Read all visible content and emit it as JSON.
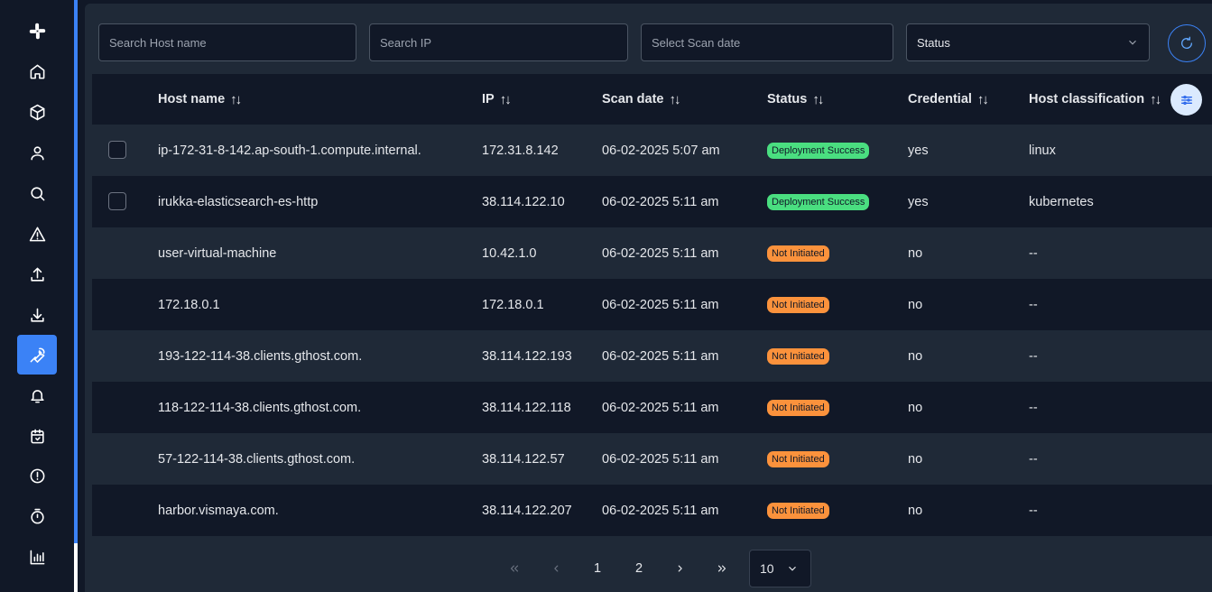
{
  "sidebar": {
    "items": [
      {
        "icon": "slack-icon"
      },
      {
        "icon": "home-icon"
      },
      {
        "icon": "cube-icon"
      },
      {
        "icon": "user-icon"
      },
      {
        "icon": "search-icon"
      },
      {
        "icon": "warning-icon"
      },
      {
        "icon": "upload-icon"
      },
      {
        "icon": "download-icon"
      },
      {
        "icon": "wrench-icon",
        "active": true
      },
      {
        "icon": "bell-icon"
      },
      {
        "icon": "calendar-icon"
      },
      {
        "icon": "alert-circle-icon"
      },
      {
        "icon": "timer-icon"
      },
      {
        "icon": "bar-chart-icon"
      }
    ]
  },
  "filters": {
    "host_placeholder": "Search Host name",
    "ip_placeholder": "Search IP",
    "date_placeholder": "Select Scan date",
    "status_label": "Status"
  },
  "table": {
    "headers": {
      "host": "Host name",
      "ip": "IP",
      "scan_date": "Scan date",
      "status": "Status",
      "credential": "Credential",
      "classification": "Host classification"
    },
    "sort_glyph": "↑↓",
    "rows": [
      {
        "host": "ip-172-31-8-142.ap-south-1.compute.internal.",
        "ip": "172.31.8.142",
        "date": "06-02-2025 5:07 am",
        "status": "Deployment Success",
        "credential": "yes",
        "classification": "linux"
      },
      {
        "host": "irukka-elasticsearch-es-http",
        "ip": "38.114.122.10",
        "date": "06-02-2025 5:11 am",
        "status": "Deployment Success",
        "credential": "yes",
        "classification": "kubernetes"
      },
      {
        "host": "user-virtual-machine",
        "ip": "10.42.1.0",
        "date": "06-02-2025 5:11 am",
        "status": "Not Initiated",
        "credential": "no",
        "classification": "--"
      },
      {
        "host": "172.18.0.1",
        "ip": "172.18.0.1",
        "date": "06-02-2025 5:11 am",
        "status": "Not Initiated",
        "credential": "no",
        "classification": "--"
      },
      {
        "host": "193-122-114-38.clients.gthost.com.",
        "ip": "38.114.122.193",
        "date": "06-02-2025 5:11 am",
        "status": "Not Initiated",
        "credential": "no",
        "classification": "--"
      },
      {
        "host": "118-122-114-38.clients.gthost.com.",
        "ip": "38.114.122.118",
        "date": "06-02-2025 5:11 am",
        "status": "Not Initiated",
        "credential": "no",
        "classification": "--"
      },
      {
        "host": "57-122-114-38.clients.gthost.com.",
        "ip": "38.114.122.57",
        "date": "06-02-2025 5:11 am",
        "status": "Not Initiated",
        "credential": "no",
        "classification": "--"
      },
      {
        "host": "harbor.vismaya.com.",
        "ip": "38.114.122.207",
        "date": "06-02-2025 5:11 am",
        "status": "Not Initiated",
        "credential": "no",
        "classification": "--"
      }
    ]
  },
  "pagination": {
    "pages": [
      "1",
      "2"
    ],
    "page_size": "10"
  },
  "colors": {
    "accent": "#3b82f6",
    "success": "#4ade80",
    "pending": "#fb923c"
  }
}
